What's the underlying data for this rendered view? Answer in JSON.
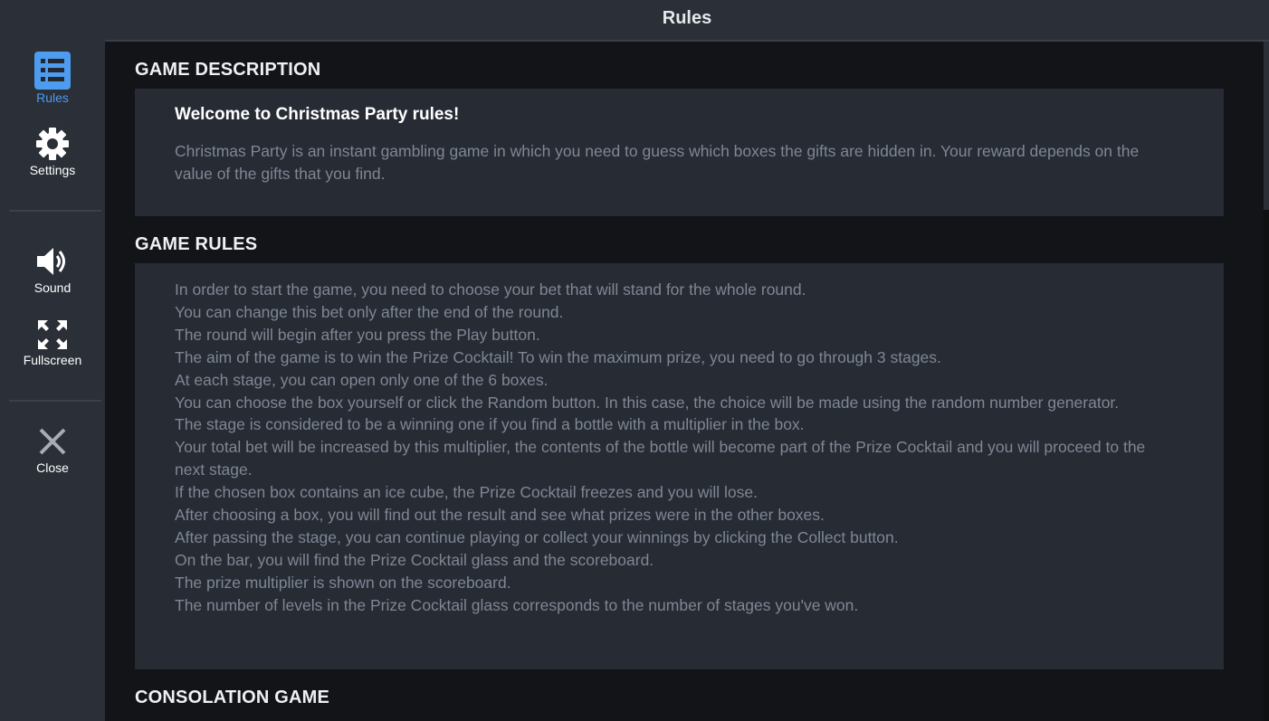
{
  "window": {
    "title": "Rules"
  },
  "sidebar": {
    "items": [
      {
        "label": "Rules",
        "icon": "rules-list-icon",
        "active": true
      },
      {
        "label": "Settings",
        "icon": "gear-icon"
      },
      {
        "label": "Sound",
        "icon": "speaker-icon"
      },
      {
        "label": "Fullscreen",
        "icon": "fullscreen-icon"
      },
      {
        "label": "Close",
        "icon": "close-icon"
      }
    ]
  },
  "colors": {
    "accent": "#4d9cf0",
    "sidebar_bg": "#2a2f38",
    "panel_bg": "#262b34",
    "page_bg": "#131417"
  },
  "sections": {
    "description": {
      "title": "GAME DESCRIPTION",
      "heading": "Welcome to Christmas Party rules!",
      "text": "Christmas Party is an instant gambling game in which you need to guess which boxes the gifts are hidden in. Your reward depends on the value of the gifts that you find."
    },
    "rules": {
      "title": "GAME RULES",
      "lines": [
        "In order to start the game, you need to choose your bet that will stand for the whole round.",
        "You can change this bet only after the end of the round.",
        "The round will begin after you press the Play button.",
        "The aim of the game is to win the Prize Cocktail! To win the maximum prize, you need to go through 3 stages.",
        "At each stage, you can open only one of the 6 boxes.",
        "You can choose the box yourself or click the Random button. In this case, the choice will be made using the random number generator.",
        "The stage is considered to be a winning one if you find a bottle with a multiplier in the box.",
        "Your total bet will be increased by this multiplier, the contents of the bottle will become part of the Prize Cocktail and you will proceed to the next stage.",
        "If the chosen box contains an ice cube, the Prize Cocktail freezes and you will lose.",
        "After choosing a box, you will find out the result and see what prizes were in the other boxes.",
        "After passing the stage, you can continue playing or collect your winnings by clicking the Collect button.",
        "On the bar, you will find the Prize Cocktail glass and the scoreboard.",
        "The prize multiplier is shown on the scoreboard.",
        "The number of levels in the Prize Cocktail glass corresponds to the number of stages you've won."
      ]
    },
    "consolation": {
      "title": "CONSOLATION GAME"
    }
  }
}
